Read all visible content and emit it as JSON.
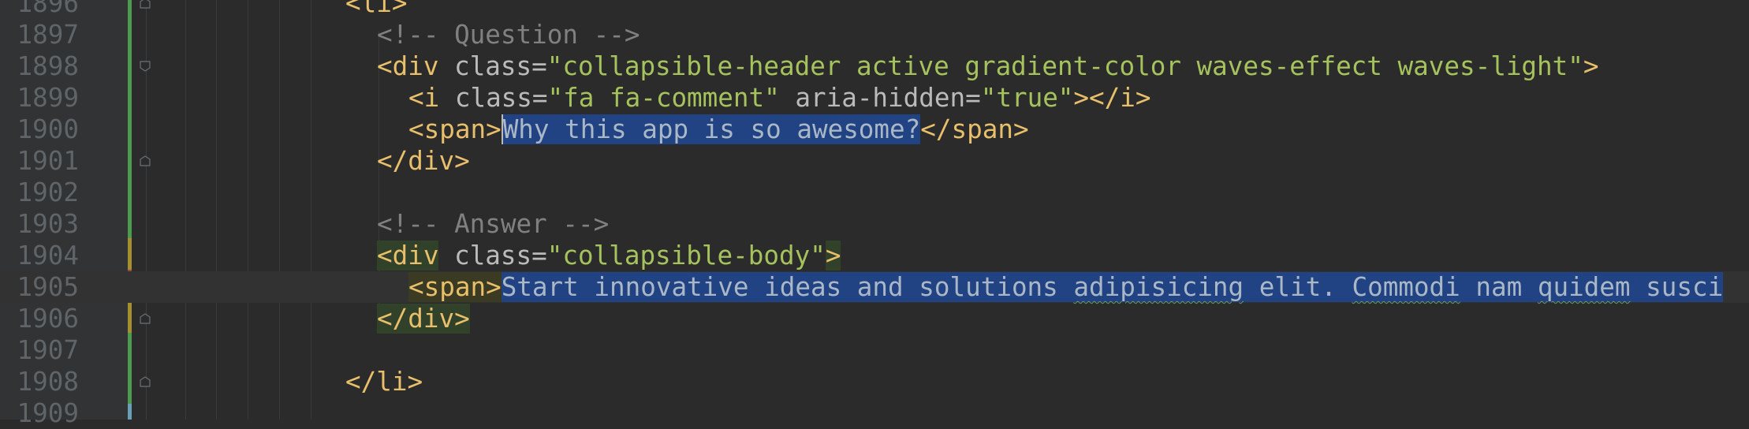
{
  "editor": {
    "lines": [
      {
        "no": "1896",
        "t": [
          [
            "tag",
            "<li>"
          ]
        ]
      },
      {
        "no": "1897",
        "t": [
          [
            "cmt",
            "<!-- Question -->"
          ]
        ]
      },
      {
        "no": "1898",
        "t": [
          [
            "tag",
            "<div "
          ],
          [
            "attr",
            "class="
          ],
          [
            "val",
            "\"collapsible-header active gradient-color waves-effect waves-light\""
          ],
          [
            "tag",
            ">"
          ]
        ]
      },
      {
        "no": "1899",
        "t": [
          [
            "tag",
            "<i "
          ],
          [
            "attr",
            "class="
          ],
          [
            "val",
            "\"fa fa-comment\""
          ],
          [
            "attr",
            " aria-hidden="
          ],
          [
            "val",
            "\"true\""
          ],
          [
            "tag",
            "></i>"
          ]
        ]
      },
      {
        "no": "1900",
        "t": [
          [
            "tag",
            "<span>"
          ],
          [
            "txt",
            "Why this app is so awesome?"
          ],
          [
            "tag",
            "</span>"
          ]
        ]
      },
      {
        "no": "1901",
        "t": [
          [
            "tag",
            "</div>"
          ]
        ]
      },
      {
        "no": "1902",
        "t": []
      },
      {
        "no": "1903",
        "t": [
          [
            "cmt",
            "<!-- Answer -->"
          ]
        ]
      },
      {
        "no": "1904",
        "t": [
          [
            "tag",
            "<div"
          ],
          [
            "attr",
            " class="
          ],
          [
            "val",
            "\"collapsible-body\""
          ],
          [
            "tag",
            ">"
          ]
        ]
      },
      {
        "no": "1905",
        "t": [
          [
            "tag",
            "<span>"
          ],
          [
            "txt",
            "Start innovative ideas and solutions "
          ],
          [
            "txt",
            "adipisicing"
          ],
          [
            "txt",
            " elit. "
          ],
          [
            "txt",
            "Commodi"
          ],
          [
            "txt",
            " nam "
          ],
          [
            "txt",
            "quidem"
          ],
          [
            "txt",
            " "
          ],
          [
            "txt",
            "susci"
          ]
        ]
      },
      {
        "no": "1906",
        "t": [
          [
            "tag",
            "</div>"
          ]
        ]
      },
      {
        "no": "1907",
        "t": []
      },
      {
        "no": "1908",
        "t": [
          [
            "tag",
            "</li>"
          ]
        ]
      },
      {
        "no": "1909",
        "t": []
      }
    ]
  },
  "colors": {
    "background": "#2b2b2b",
    "tag": "#e8bf6a",
    "attribute": "#bababa",
    "string": "#a5c25c",
    "comment": "#808080",
    "selection": "#214283",
    "vcs_added": "#4e9a4e",
    "vcs_modified": "#a68f2e",
    "vcs_deleted": "#a04848"
  }
}
